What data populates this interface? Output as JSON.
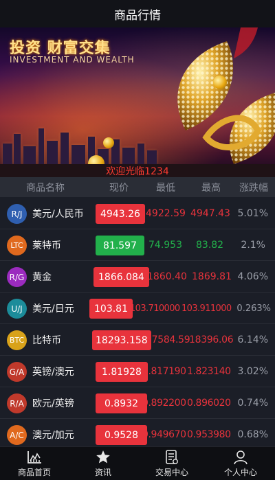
{
  "header": {
    "title": "商品行情"
  },
  "banner": {
    "title_cn": "投资 财富交集",
    "title_en": "INVESTMENT AND WEALTH"
  },
  "welcome": "欢迎光临1234",
  "columns": {
    "name": "商品名称",
    "price": "现价",
    "low": "最低",
    "high": "最高",
    "change": "涨跌幅"
  },
  "colors": {
    "up": "#e8333c",
    "down": "#22b04b",
    "badge_blue": "#2f5fb0",
    "badge_orange": "#e0691e",
    "badge_purple": "#9b2bbf",
    "badge_teal": "#1c8c9a",
    "badge_gold": "#d8a21a",
    "badge_red": "#c0392b"
  },
  "rows": [
    {
      "badge": "R/J",
      "badge_color": "#2f5fb0",
      "name": "美元/人民币",
      "price": "4943.26",
      "low": "4922.59",
      "high": "4947.43",
      "change": "5.01%",
      "trend": "up"
    },
    {
      "badge": "LTC",
      "badge_color": "#e0691e",
      "name": "莱特币",
      "price": "81.597",
      "low": "74.953",
      "high": "83.82",
      "change": "2.1%",
      "trend": "down"
    },
    {
      "badge": "R/G",
      "badge_color": "#9b2bbf",
      "name": "黄金",
      "price": "1866.084",
      "low": "1860.40",
      "high": "1869.81",
      "change": "4.06%",
      "trend": "up"
    },
    {
      "badge": "U/J",
      "badge_color": "#1c8c9a",
      "name": "美元/日元",
      "price": "103.81",
      "low": "103.710000",
      "high": "103.911000",
      "change": "0.263%",
      "trend": "up"
    },
    {
      "badge": "BTC",
      "badge_color": "#d8a21a",
      "name": "比特币",
      "price": "18293.158",
      "low": "17584.59",
      "high": "18396.06",
      "change": "6.14%",
      "trend": "up"
    },
    {
      "badge": "G/A",
      "badge_color": "#c0392b",
      "name": "英镑/澳元",
      "price": "1.81928",
      "low": "1.817190",
      "high": "1.823140",
      "change": "3.02%",
      "trend": "up"
    },
    {
      "badge": "R/A",
      "badge_color": "#c0392b",
      "name": "欧元/英镑",
      "price": "0.8932",
      "low": "0.892200",
      "high": "0.896020",
      "change": "0.74%",
      "trend": "up"
    },
    {
      "badge": "A/C",
      "badge_color": "#e0691e",
      "name": "澳元/加元",
      "price": "0.9528",
      "low": "0.949670",
      "high": "0.953980",
      "change": "0.68%",
      "trend": "up"
    }
  ],
  "tabs": [
    {
      "label": "商品首页",
      "icon": "chart-icon"
    },
    {
      "label": "资讯",
      "icon": "star-icon"
    },
    {
      "label": "交易中心",
      "icon": "document-icon"
    },
    {
      "label": "个人中心",
      "icon": "person-icon"
    }
  ]
}
